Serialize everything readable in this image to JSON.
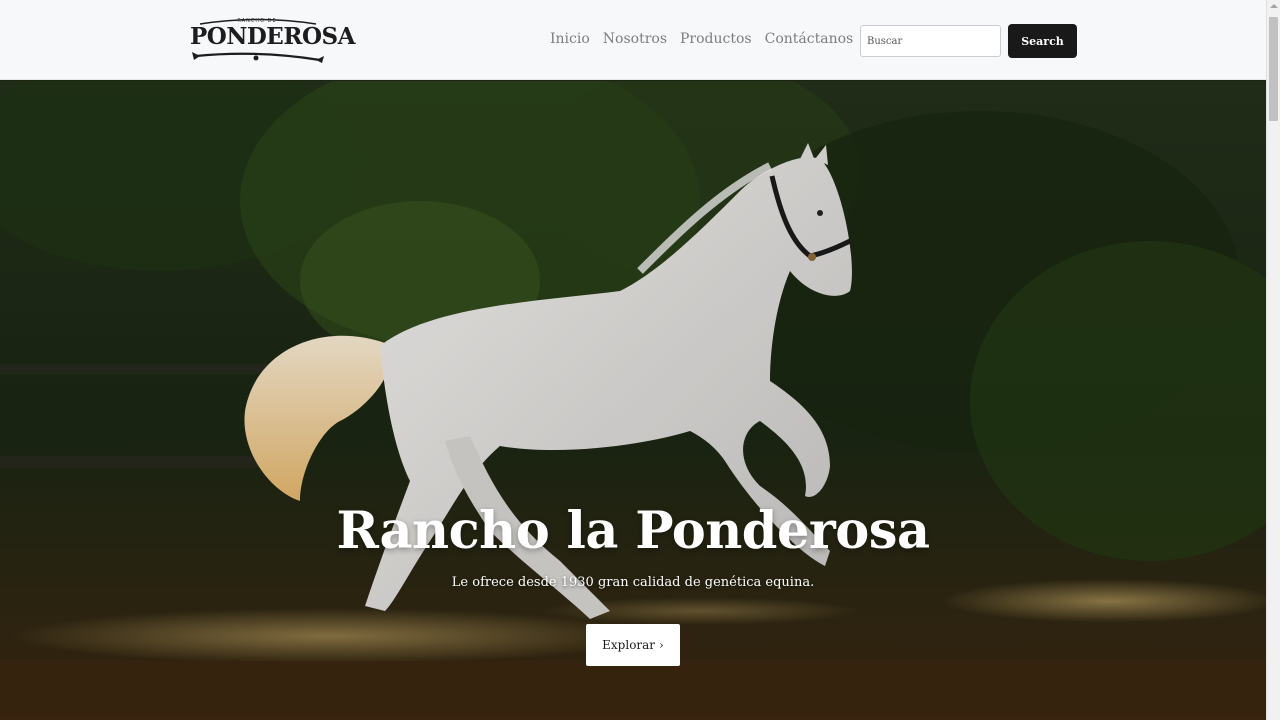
{
  "brand": {
    "small_text": "RANCHO DE",
    "logo_text": "PONDEROSA"
  },
  "nav": {
    "links": [
      "Inicio",
      "Nosotros",
      "Productos",
      "Contáctanos"
    ]
  },
  "search": {
    "placeholder": "Buscar",
    "button_label": "Search"
  },
  "hero": {
    "title": "Rancho la Ponderosa",
    "subtitle": "Le ofrece desde 1930 gran calidad de genética equina.",
    "button_label": "Explorar",
    "button_icon": "chevron-right-icon",
    "button_icon_glyph": "›"
  },
  "colors": {
    "navbar_bg": "#f7f8fa",
    "nav_link": "#7d7d7d",
    "search_button_bg": "#191919",
    "hero_text": "#ffffff"
  }
}
